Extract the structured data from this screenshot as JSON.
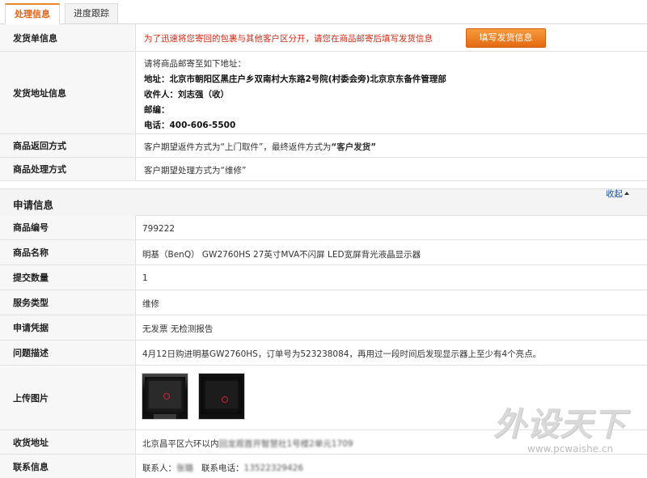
{
  "tabs": {
    "active": "处理信息",
    "inactive": "进度跟踪"
  },
  "shipping": {
    "label": "发货单信息",
    "notice": "为了迅速将您寄回的包裹与其他客户区分开，请您在商品邮寄后填写发货信息",
    "button": "填写发货信息"
  },
  "address": {
    "label": "发货地址信息",
    "intro": "请将商品邮寄至如下地址：",
    "line_address": "地址：北京市朝阳区黑庄户乡双南村大东路2号院(村委会旁)北京京东备件管理部",
    "line_recipient": "收件人：刘志强（收）",
    "line_postcode": "邮编：",
    "line_phone": "电话：400-606-5500"
  },
  "return_method": {
    "label": "商品返回方式",
    "prefix": "客户期望返件方式为“上门取件”，最终返件方式为",
    "final": "“客户发货”"
  },
  "process_method": {
    "label": "商品处理方式",
    "value": "客户期望处理方式为“维修”"
  },
  "apply_section": {
    "title": "申请信息",
    "collapse": "收起"
  },
  "fields": {
    "product_id": {
      "label": "商品编号",
      "value": "799222"
    },
    "product_name": {
      "label": "商品名称",
      "value": "明基（BenQ） GW2760HS 27英寸MVA不闪屏 LED宽屏背光液晶显示器"
    },
    "quantity": {
      "label": "提交数量",
      "value": "1"
    },
    "service_type": {
      "label": "服务类型",
      "value": "维修"
    },
    "proof": {
      "label": "申请凭据",
      "value": "无发票 无检测报告"
    },
    "problem": {
      "label": "问题描述",
      "value": "4月12日购进明基GW2760HS，订单号为523238084，再用过一段时间后发现显示器上至少有4个亮点。"
    },
    "photos": {
      "label": "上传图片"
    },
    "receive_address": {
      "label": "收货地址",
      "value": "北京昌平区六环以内",
      "value_blurred": "回龙观首开智慧社1号楼2单元1709"
    },
    "contact": {
      "label": "联系信息",
      "name_label": "联系人：",
      "name_value": "张璐",
      "phone_label": "联系电话：",
      "phone_value": "13522329426"
    }
  },
  "watermark": {
    "brand": "外设天下",
    "url": "www.pcwaishe.cn"
  }
}
